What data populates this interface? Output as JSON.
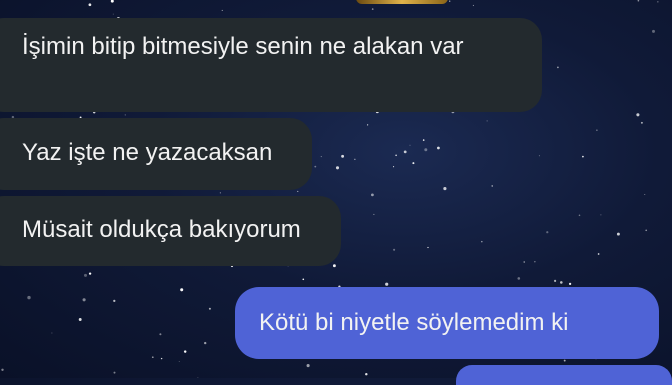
{
  "messages": {
    "received": [
      {
        "text": "İşimin bitip bitmesiyle senin ne alakan var"
      },
      {
        "text": "Yaz işte ne yazacaksan"
      },
      {
        "text": "Müsait oldukça bakıyorum"
      }
    ],
    "sent": [
      {
        "text": "Kötü bi niyetle söylemedim ki"
      }
    ]
  },
  "colors": {
    "background": "#101a38",
    "received_bubble": "#232a2e",
    "sent_bubble": "#4f63d6",
    "text": "#f2f2f2"
  }
}
